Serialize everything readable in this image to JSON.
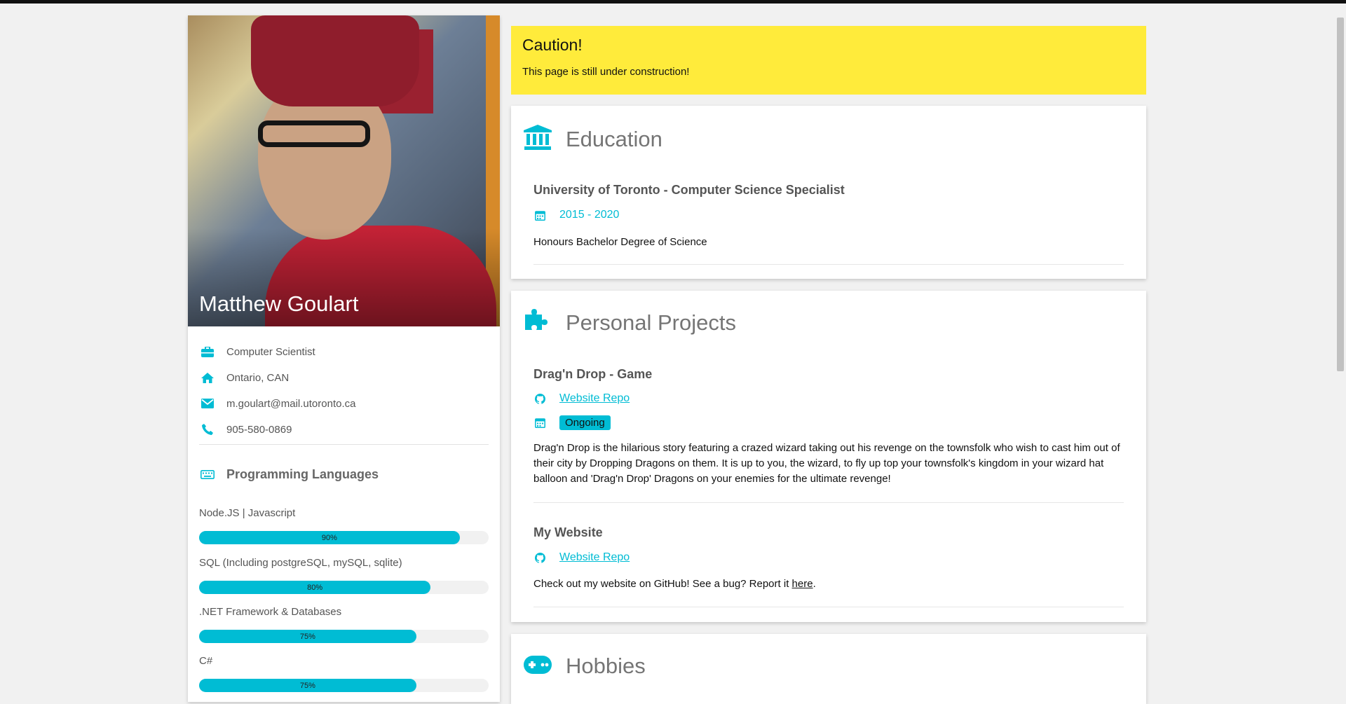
{
  "profile": {
    "name": "Matthew Goulart",
    "info": [
      {
        "icon": "briefcase-icon",
        "text": "Computer Scientist"
      },
      {
        "icon": "home-icon",
        "text": "Ontario, CAN"
      },
      {
        "icon": "envelope-icon",
        "text": "m.goulart@mail.utoronto.ca"
      },
      {
        "icon": "phone-icon",
        "text": "905-580-0869"
      }
    ],
    "languages_title": "Programming Languages",
    "skills": [
      {
        "label": "Node.JS | Javascript",
        "percent": 90,
        "percent_text": "90%"
      },
      {
        "label": "SQL (Including postgreSQL, mySQL, sqlite)",
        "percent": 80,
        "percent_text": "80%"
      },
      {
        "label": ".NET Framework & Databases",
        "percent": 75,
        "percent_text": "75%"
      },
      {
        "label": "C#",
        "percent": 75,
        "percent_text": "75%"
      }
    ]
  },
  "caution": {
    "title": "Caution!",
    "message": "This page is still under construction!"
  },
  "education": {
    "title": "Education",
    "entries": [
      {
        "title": "University of Toronto - Computer Science Specialist",
        "dates": "2015 - 2020",
        "description": "Honours Bachelor Degree of Science"
      }
    ]
  },
  "projects": {
    "title": "Personal Projects",
    "entries": [
      {
        "title": "Drag'n Drop - Game",
        "repo_label": "Website Repo",
        "status": "Ongoing",
        "description": "Drag'n Drop is the hilarious story featuring a crazed wizard taking out his revenge on the townsfolk who wish to cast him out of their city by Dropping Dragons on them. It is up to you, the wizard, to fly up top your townsfolk's kingdom in your wizard hat balloon and 'Drag'n Drop' Dragons on your enemies for the ultimate revenge!"
      },
      {
        "title": "My Website",
        "repo_label": "Website Repo",
        "description_prefix": "Check out my website on GitHub! See a bug? Report it ",
        "description_link": "here",
        "description_suffix": "."
      }
    ]
  },
  "hobbies": {
    "title": "Hobbies"
  },
  "colors": {
    "accent": "#00bcd4",
    "caution": "#ffeb3b",
    "background": "#f1f1f1"
  }
}
